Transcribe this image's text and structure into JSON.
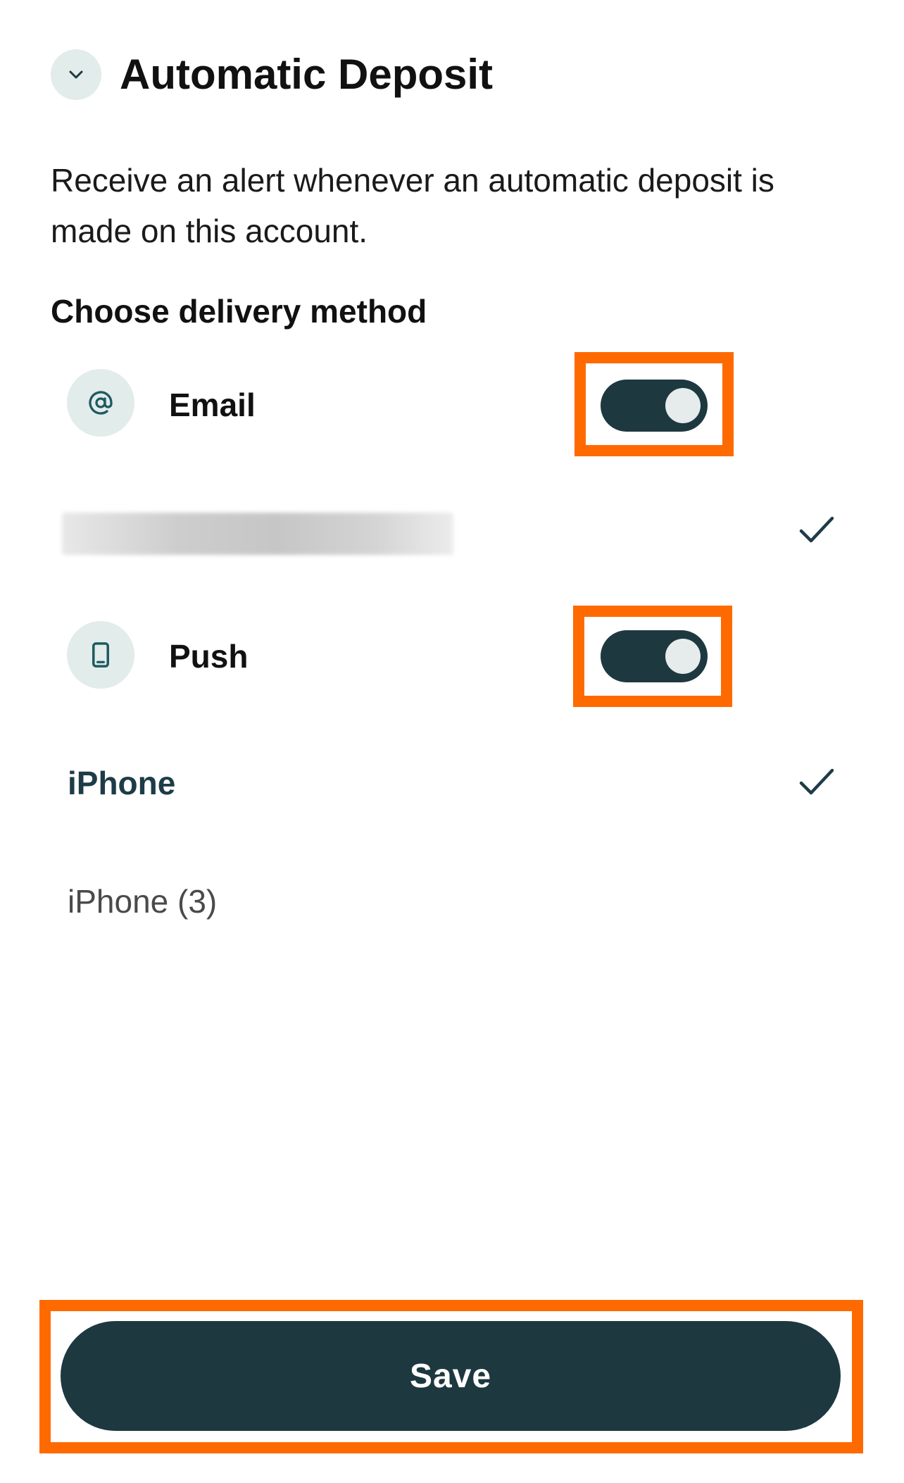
{
  "header": {
    "title": "Automatic Deposit",
    "collapse_icon": "chevron-down-icon"
  },
  "description": "Receive an alert whenever an automatic deposit is made on this account.",
  "section_label": "Choose delivery method",
  "methods": [
    {
      "label": "Email",
      "icon": "at-sign-icon",
      "enabled": true,
      "destinations": [
        {
          "label": "",
          "redacted": true,
          "selected": true
        }
      ]
    },
    {
      "label": "Push",
      "icon": "phone-icon",
      "enabled": true,
      "destinations": [
        {
          "label": "iPhone",
          "selected": true
        },
        {
          "label": "iPhone (3)",
          "selected": false
        }
      ]
    }
  ],
  "save_label": "Save",
  "colors": {
    "primary": "#1e3840",
    "icon_bg": "#e2ecea",
    "highlight": "#ff6a00",
    "accent_text": "#1d3c48"
  }
}
